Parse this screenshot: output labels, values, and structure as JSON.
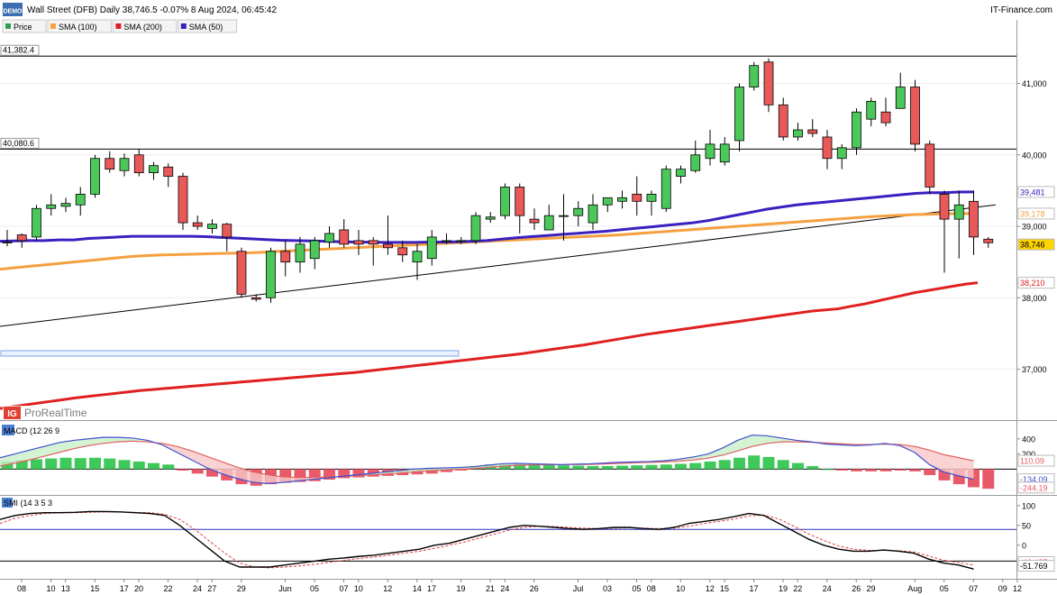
{
  "header": {
    "logo_text": "DEMO",
    "title": "Wall Street (DFB) Daily 38,746.5 -0.07% 8 Aug 2024, 06:45:42",
    "source": "IT-Finance.com"
  },
  "legend": [
    {
      "label": "Price",
      "color": "#2e9e4e",
      "key": "price"
    },
    {
      "label": "SMA (100)",
      "color": "#f5a040",
      "key": "sma100"
    },
    {
      "label": "SMA (200)",
      "color": "#e02020",
      "key": "sma200"
    },
    {
      "label": "SMA (50)",
      "color": "#3a20c0",
      "key": "sma50"
    }
  ],
  "watermark": {
    "logo": "IG",
    "text": "ProRealTime"
  },
  "colors": {
    "up": "#4cc85a",
    "down": "#e85a5a",
    "sma50": "#3a20c0",
    "sma100": "#f5a040",
    "sma200": "#e02020",
    "smi": "#000000",
    "smi_signal": "#e04040",
    "macd_line": "#4050d0",
    "macd_signal": "#e06060"
  },
  "chart_data": [
    {
      "type": "candlestick",
      "ylim": [
        36300,
        41600
      ],
      "y_ticks": [
        {
          "v": 37000,
          "label": "37,000"
        },
        {
          "v": 38000,
          "label": "38,000"
        },
        {
          "v": 39000,
          "label": "39,000"
        },
        {
          "v": 40000,
          "label": "40,000"
        },
        {
          "v": 41000,
          "label": "41,000"
        }
      ],
      "x_ticks": [
        {
          "i": 0,
          "label": "08"
        },
        {
          "i": 2,
          "label": "10"
        },
        {
          "i": 3,
          "label": "13"
        },
        {
          "i": 5,
          "label": "15"
        },
        {
          "i": 7,
          "label": "17"
        },
        {
          "i": 8,
          "label": "20"
        },
        {
          "i": 10,
          "label": "22"
        },
        {
          "i": 12,
          "label": "24"
        },
        {
          "i": 13,
          "label": "27"
        },
        {
          "i": 15,
          "label": "29"
        },
        {
          "i": 18,
          "label": "Jun"
        },
        {
          "i": 20,
          "label": "05"
        },
        {
          "i": 22,
          "label": "07"
        },
        {
          "i": 23,
          "label": "10"
        },
        {
          "i": 25,
          "label": "12"
        },
        {
          "i": 27,
          "label": "14"
        },
        {
          "i": 28,
          "label": "17"
        },
        {
          "i": 30,
          "label": "19"
        },
        {
          "i": 32,
          "label": "21"
        },
        {
          "i": 33,
          "label": "24"
        },
        {
          "i": 35,
          "label": "26"
        },
        {
          "i": 38,
          "label": "Jul"
        },
        {
          "i": 40,
          "label": "03"
        },
        {
          "i": 42,
          "label": "05"
        },
        {
          "i": 43,
          "label": "08"
        },
        {
          "i": 45,
          "label": "10"
        },
        {
          "i": 47,
          "label": "12"
        },
        {
          "i": 48,
          "label": "15"
        },
        {
          "i": 50,
          "label": "17"
        },
        {
          "i": 52,
          "label": "19"
        },
        {
          "i": 53,
          "label": "22"
        },
        {
          "i": 55,
          "label": "24"
        },
        {
          "i": 57,
          "label": "26"
        },
        {
          "i": 58,
          "label": "29"
        },
        {
          "i": 61,
          "label": "Aug"
        },
        {
          "i": 63,
          "label": "05"
        },
        {
          "i": 65,
          "label": "07"
        },
        {
          "i": 67,
          "label": "09"
        },
        {
          "i": 68,
          "label": "12"
        }
      ],
      "candles": [
        [
          38780,
          38950,
          38720,
          38780
        ],
        [
          38880,
          38900,
          38700,
          38800
        ],
        [
          38850,
          39300,
          38800,
          39250
        ],
        [
          39250,
          39450,
          39150,
          39300
        ],
        [
          39280,
          39400,
          39200,
          39320
        ],
        [
          39300,
          39550,
          39150,
          39450
        ],
        [
          39450,
          40000,
          39400,
          39950
        ],
        [
          39950,
          40050,
          39750,
          39800
        ],
        [
          39780,
          40020,
          39700,
          39950
        ],
        [
          40000,
          40080,
          39700,
          39750
        ],
        [
          39750,
          39900,
          39650,
          39850
        ],
        [
          39830,
          39880,
          39550,
          39700
        ],
        [
          39700,
          39750,
          38950,
          39050
        ],
        [
          39050,
          39150,
          38950,
          39000
        ],
        [
          38970,
          39100,
          38900,
          39030
        ],
        [
          39030,
          39050,
          38650,
          38850
        ],
        [
          38650,
          38700,
          38000,
          38050
        ],
        [
          38000,
          38050,
          37950,
          37980
        ],
        [
          38000,
          38700,
          37930,
          38650
        ],
        [
          38650,
          38800,
          38300,
          38500
        ],
        [
          38500,
          38850,
          38350,
          38750
        ],
        [
          38550,
          38850,
          38400,
          38800
        ],
        [
          38780,
          39000,
          38700,
          38900
        ],
        [
          38950,
          39100,
          38700,
          38750
        ],
        [
          38800,
          38950,
          38600,
          38750
        ],
        [
          38800,
          38850,
          38450,
          38750
        ],
        [
          38750,
          39150,
          38600,
          38700
        ],
        [
          38700,
          38800,
          38500,
          38600
        ],
        [
          38500,
          38750,
          38250,
          38650
        ],
        [
          38550,
          38950,
          38450,
          38850
        ],
        [
          38800,
          38900,
          38750,
          38800
        ],
        [
          38800,
          38850,
          38750,
          38800
        ],
        [
          38800,
          39200,
          38750,
          39150
        ],
        [
          39100,
          39200,
          39050,
          39130
        ],
        [
          39150,
          39600,
          39100,
          39550
        ],
        [
          39550,
          39600,
          38900,
          39150
        ],
        [
          39100,
          39250,
          38950,
          39050
        ],
        [
          38950,
          39300,
          38950,
          39150
        ],
        [
          39150,
          39450,
          38800,
          39150
        ],
        [
          39150,
          39350,
          39000,
          39250
        ],
        [
          39050,
          39450,
          38950,
          39300
        ],
        [
          39300,
          39400,
          39200,
          39400
        ],
        [
          39350,
          39500,
          39250,
          39400
        ],
        [
          39450,
          39700,
          39150,
          39350
        ],
        [
          39350,
          39500,
          39150,
          39450
        ],
        [
          39250,
          39850,
          39200,
          39800
        ],
        [
          39700,
          39850,
          39600,
          39800
        ],
        [
          39780,
          40200,
          39750,
          40000
        ],
        [
          39950,
          40350,
          39850,
          40150
        ],
        [
          39900,
          40250,
          39850,
          40150
        ],
        [
          40200,
          41000,
          40050,
          40950
        ],
        [
          40950,
          41300,
          40900,
          41250
        ],
        [
          41300,
          41350,
          40600,
          40700
        ],
        [
          40700,
          40800,
          40200,
          40250
        ],
        [
          40250,
          40450,
          40200,
          40350
        ],
        [
          40350,
          40500,
          40250,
          40300
        ],
        [
          40250,
          40350,
          39800,
          39950
        ],
        [
          39950,
          40150,
          39800,
          40100
        ],
        [
          40100,
          40650,
          40000,
          40600
        ],
        [
          40500,
          40800,
          40400,
          40750
        ],
        [
          40600,
          40800,
          40400,
          40450
        ],
        [
          40650,
          41150,
          40650,
          40950
        ],
        [
          40950,
          41050,
          40050,
          40150
        ],
        [
          40150,
          40200,
          39450,
          39550
        ],
        [
          39450,
          39500,
          38350,
          39100
        ],
        [
          39100,
          39500,
          38550,
          39300
        ],
        [
          39350,
          39500,
          38600,
          38850
        ],
        [
          38820,
          38850,
          38700,
          38770
        ]
      ],
      "sma50": [
        38790,
        38795,
        38800,
        38800,
        38810,
        38810,
        38830,
        38840,
        38850,
        38860,
        38860,
        38860,
        38860,
        38860,
        38855,
        38845,
        38835,
        38825,
        38815,
        38805,
        38800,
        38795,
        38790,
        38785,
        38780,
        38778,
        38775,
        38775,
        38775,
        38778,
        38780,
        38785,
        38790,
        38800,
        38820,
        38840,
        38855,
        38870,
        38885,
        38900,
        38915,
        38930,
        38950,
        38970,
        38990,
        39010,
        39030,
        39050,
        39080,
        39120,
        39160,
        39200,
        39240,
        39270,
        39300,
        39320,
        39340,
        39360,
        39380,
        39400,
        39420,
        39440,
        39460,
        39470,
        39470,
        39480,
        39481
      ],
      "sma100": [
        38400,
        38420,
        38440,
        38460,
        38480,
        38500,
        38520,
        38540,
        38560,
        38580,
        38590,
        38600,
        38605,
        38610,
        38615,
        38620,
        38625,
        38630,
        38640,
        38650,
        38660,
        38670,
        38680,
        38690,
        38700,
        38710,
        38720,
        38730,
        38740,
        38750,
        38760,
        38770,
        38780,
        38790,
        38800,
        38810,
        38820,
        38830,
        38840,
        38850,
        38860,
        38870,
        38880,
        38895,
        38910,
        38925,
        38940,
        38955,
        38970,
        38985,
        39000,
        39015,
        39030,
        39045,
        39060,
        39075,
        39090,
        39105,
        39120,
        39135,
        39145,
        39155,
        39165,
        39170,
        39175,
        39178,
        39178
      ],
      "sma200": [
        36450,
        36475,
        36500,
        36525,
        36550,
        36575,
        36600,
        36620,
        36640,
        36660,
        36680,
        36700,
        36715,
        36730,
        36745,
        36760,
        36775,
        36790,
        36805,
        36820,
        36835,
        36850,
        36865,
        36880,
        36895,
        36910,
        36925,
        36940,
        36955,
        36975,
        36995,
        37015,
        37035,
        37055,
        37075,
        37095,
        37115,
        37135,
        37155,
        37175,
        37195,
        37215,
        37240,
        37265,
        37290,
        37315,
        37340,
        37370,
        37400,
        37430,
        37460,
        37490,
        37515,
        37540,
        37565,
        37590,
        37615,
        37640,
        37665,
        37690,
        37715,
        37740,
        37765,
        37790,
        37815,
        37830,
        37845,
        37880,
        37910,
        37950,
        37990,
        38030,
        38070,
        38100,
        38130,
        38160,
        38190,
        38210
      ],
      "hlines": [
        {
          "v": 41382.4,
          "label": "41,382.4"
        },
        {
          "v": 40080.6,
          "label": "40,080.6"
        }
      ],
      "trendline": {
        "from": {
          "i": -0.5,
          "v": 37600
        },
        "to": {
          "i": 67.5,
          "v": 39300
        }
      },
      "value_labels": [
        {
          "v": 39481,
          "label": "39,481",
          "kind": "sma50"
        },
        {
          "v": 39178,
          "label": "39,178",
          "kind": "sma100"
        },
        {
          "v": 38746,
          "label": "38,746",
          "kind": "price"
        },
        {
          "v": 38210,
          "label": "38,210",
          "kind": "sma200"
        }
      ]
    },
    {
      "type": "macd",
      "title": "MACD (12 26 9",
      "ylim": [
        -330,
        600
      ],
      "y_ticks": [
        {
          "v": 400,
          "label": "400"
        },
        {
          "v": 200,
          "label": "200"
        }
      ],
      "histogram": [
        100,
        120,
        130,
        140,
        150,
        145,
        150,
        140,
        120,
        100,
        80,
        60,
        -20,
        -60,
        -100,
        -150,
        -200,
        -220,
        -200,
        -180,
        -170,
        -160,
        -140,
        -120,
        -110,
        -100,
        -90,
        -80,
        -70,
        -60,
        -40,
        -20,
        40,
        60,
        70,
        70,
        65,
        60,
        50,
        45,
        40,
        40,
        45,
        50,
        55,
        60,
        70,
        80,
        100,
        120,
        150,
        180,
        160,
        120,
        80,
        40,
        0,
        -20,
        -30,
        -30,
        -30,
        -20,
        -30,
        -80,
        -150,
        -200,
        -240,
        -260
      ],
      "macd_line": [
        150,
        200,
        250,
        300,
        350,
        380,
        400,
        420,
        420,
        410,
        380,
        320,
        220,
        120,
        20,
        -60,
        -120,
        -170,
        -190,
        -180,
        -160,
        -140,
        -120,
        -100,
        -80,
        -60,
        -40,
        -20,
        0,
        10,
        15,
        20,
        30,
        50,
        70,
        75,
        70,
        65,
        60,
        65,
        70,
        80,
        90,
        95,
        100,
        110,
        130,
        160,
        200,
        280,
        380,
        450,
        440,
        410,
        380,
        360,
        330,
        320,
        310,
        320,
        340,
        310,
        220,
        60,
        -40,
        -90,
        -134
      ],
      "signal_line": [
        40,
        80,
        120,
        170,
        220,
        270,
        310,
        340,
        360,
        370,
        360,
        340,
        300,
        240,
        170,
        100,
        30,
        -30,
        -70,
        -100,
        -110,
        -110,
        -105,
        -100,
        -90,
        -80,
        -70,
        -55,
        -40,
        -25,
        -15,
        -5,
        5,
        20,
        35,
        50,
        55,
        58,
        58,
        60,
        62,
        68,
        75,
        82,
        88,
        95,
        105,
        120,
        145,
        185,
        240,
        300,
        340,
        360,
        360,
        355,
        345,
        335,
        325,
        325,
        330,
        325,
        300,
        250,
        190,
        150,
        110
      ],
      "value_labels": [
        {
          "v": 110.09,
          "label": "110.09",
          "kind": "signal"
        },
        {
          "v": -134.09,
          "label": "-134.09",
          "kind": "macd"
        },
        {
          "v": -244.19,
          "label": "-244.19",
          "kind": "hist"
        }
      ]
    },
    {
      "type": "smi",
      "title": "SMI (14 3 5 3",
      "ylim": [
        -80,
        120
      ],
      "y_ticks": [
        {
          "v": 100,
          "label": "100"
        },
        {
          "v": 50,
          "label": "50"
        },
        {
          "v": 0,
          "label": "0"
        },
        {
          "v": -50,
          "label": "-50"
        }
      ],
      "hlines": [
        40,
        -40
      ],
      "smi_line": [
        65,
        75,
        80,
        82,
        82,
        83,
        85,
        85,
        84,
        82,
        80,
        75,
        50,
        20,
        -10,
        -40,
        -55,
        -55,
        -55,
        -50,
        -45,
        -40,
        -35,
        -32,
        -28,
        -25,
        -20,
        -15,
        -10,
        0,
        5,
        15,
        25,
        35,
        45,
        50,
        48,
        45,
        42,
        40,
        42,
        45,
        45,
        42,
        40,
        45,
        55,
        60,
        65,
        72,
        80,
        75,
        55,
        35,
        15,
        0,
        -10,
        -15,
        -15,
        -12,
        -15,
        -20,
        -35,
        -45,
        -50,
        -60
      ],
      "signal_line": [
        55,
        68,
        75,
        80,
        82,
        82,
        83,
        84,
        84,
        83,
        82,
        78,
        65,
        40,
        10,
        -20,
        -45,
        -55,
        -57,
        -55,
        -52,
        -48,
        -43,
        -38,
        -33,
        -30,
        -25,
        -20,
        -15,
        -8,
        0,
        8,
        18,
        28,
        38,
        45,
        48,
        47,
        45,
        43,
        42,
        43,
        44,
        43,
        42,
        43,
        48,
        55,
        60,
        66,
        74,
        76,
        66,
        48,
        28,
        12,
        -2,
        -10,
        -13,
        -13,
        -14,
        -17,
        -27,
        -38,
        -44,
        -50
      ],
      "value_labels": [
        {
          "v": -42.487,
          "label": "-42.487",
          "kind": "signal"
        },
        {
          "v": -51.769,
          "label": "-51.769",
          "kind": "smi"
        }
      ]
    }
  ]
}
